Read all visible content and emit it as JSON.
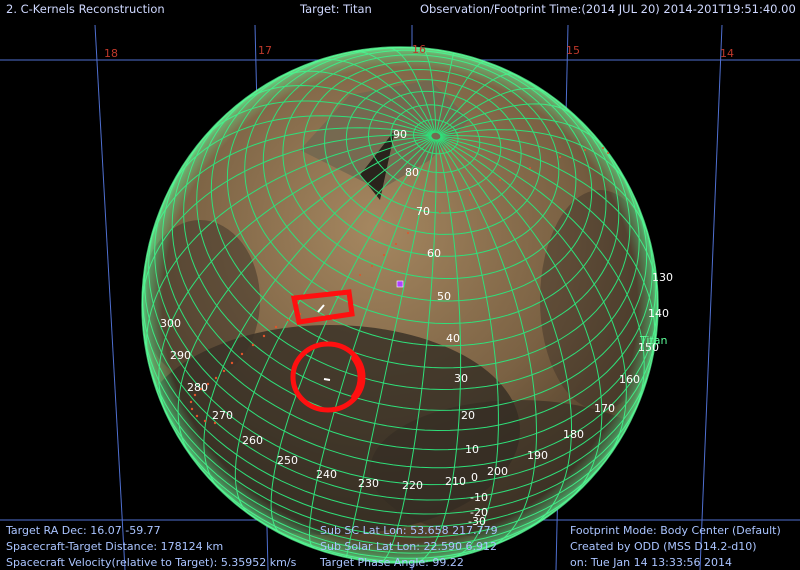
{
  "header": {
    "window_title": "2. C-Kernels Reconstruction",
    "target": "Target: Titan",
    "time": "Observation/Footprint Time:(2014 JUL 20) 2014-201T19:51:40.00"
  },
  "ra_hour_labels": [
    "18",
    "17",
    "16",
    "15",
    "14"
  ],
  "latitude_labels": [
    "90",
    "80",
    "70",
    "60",
    "50",
    "40",
    "30",
    "20",
    "10",
    "0",
    "-10",
    "-20",
    "-30"
  ],
  "longitude_labels": [
    "300",
    "290",
    "280",
    "270",
    "260",
    "250",
    "240",
    "230",
    "220",
    "210",
    "200",
    "190",
    "180",
    "170",
    "160",
    "150",
    "140",
    "130"
  ],
  "body_label": "Titan",
  "info_left": {
    "ra_dec": "Target RA Dec: 16.07   -59.77",
    "distance": "Spacecraft-Target Distance:  178124 km",
    "velocity": "Spacecraft Velocity(relative to Target): 5.35952 km/s"
  },
  "info_mid": {
    "sub_sc": "Sub SC Lat Lon: 53.658   217.779",
    "sub_solar": "Sub Solar Lat Lon: 22.590    6.912",
    "phase": "Target Phase Angle: 99.22"
  },
  "info_right": {
    "footprint_mode": "Footprint Mode: Body Center (Default)",
    "created_by": "Created by ODD (MSS D14.2-d10)",
    "created_on": "on: Tue Jan 14 13:33:56 2014"
  },
  "colors": {
    "grid": "#2fe07a",
    "sky_grid": "#4f6fd0",
    "footprint": "#ff1010",
    "track": "#e0552a",
    "marker": "#b040ff"
  }
}
